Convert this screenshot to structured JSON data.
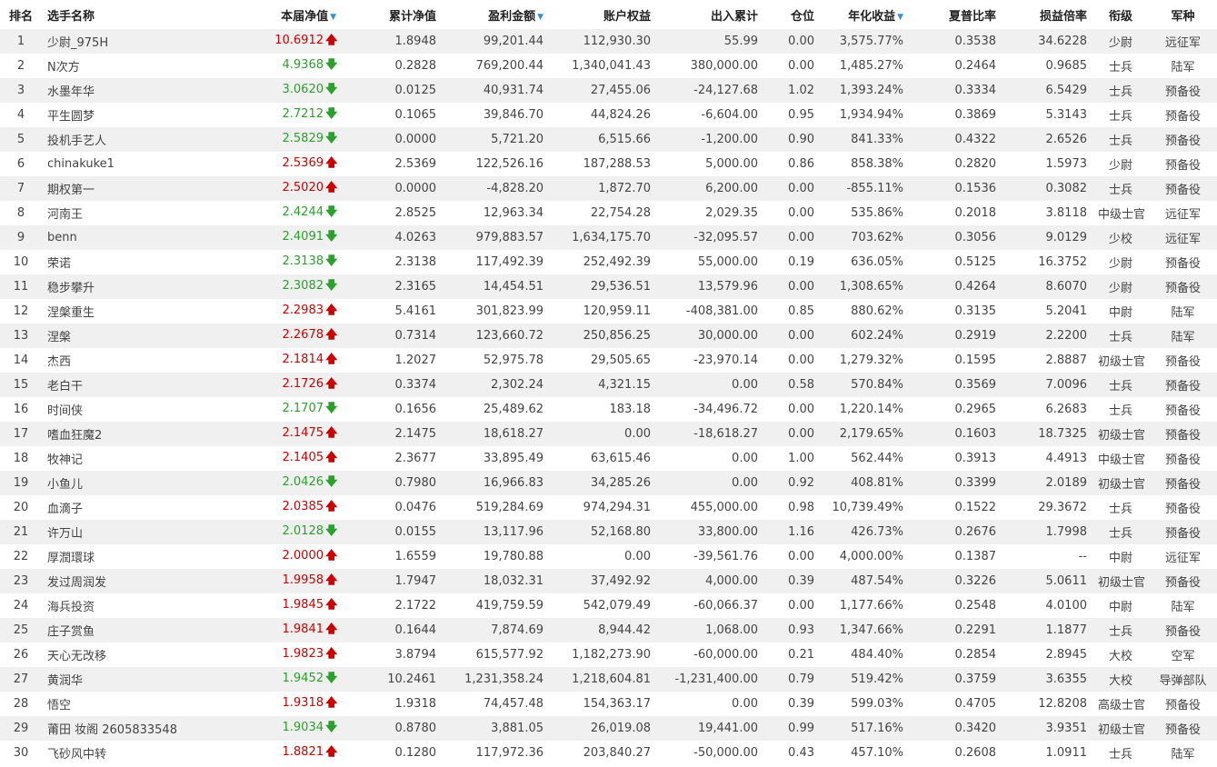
{
  "headers": {
    "rank": "排名",
    "name": "选手名称",
    "nav": "本届净值",
    "cum_nav": "累计净值",
    "profit": "盈利金额",
    "equity": "账户权益",
    "flow": "出入累计",
    "position": "仓位",
    "annual": "年化收益",
    "sharpe": "夏普比率",
    "pl_ratio": "损益倍率",
    "rank_title": "衔级",
    "army": "军种"
  },
  "sortable_columns": [
    "nav",
    "profit",
    "annual"
  ],
  "colors": {
    "up": "#cc0000",
    "down": "#2aa12a",
    "sort": "#3a8fd6",
    "stripe": "#f0f0f0"
  },
  "rows": [
    {
      "rank": "1",
      "name": "少尉_975H",
      "nav": "10.6912",
      "trend": "up",
      "cum_nav": "1.8948",
      "profit": "99,201.44",
      "equity": "112,930.30",
      "flow": "55.99",
      "position": "0.00",
      "annual": "3,575.77%",
      "sharpe": "0.3538",
      "pl_ratio": "34.6228",
      "rank_title": "少尉",
      "army": "远征军"
    },
    {
      "rank": "2",
      "name": "N次方",
      "nav": "4.9368",
      "trend": "down",
      "cum_nav": "0.2828",
      "profit": "769,200.44",
      "equity": "1,340,041.43",
      "flow": "380,000.00",
      "position": "0.00",
      "annual": "1,485.27%",
      "sharpe": "0.2464",
      "pl_ratio": "0.9685",
      "rank_title": "士兵",
      "army": "陆军"
    },
    {
      "rank": "3",
      "name": "水墨年华",
      "nav": "3.0620",
      "trend": "down",
      "cum_nav": "0.0125",
      "profit": "40,931.74",
      "equity": "27,455.06",
      "flow": "-24,127.68",
      "position": "1.02",
      "annual": "1,393.24%",
      "sharpe": "0.3334",
      "pl_ratio": "6.5429",
      "rank_title": "士兵",
      "army": "预备役"
    },
    {
      "rank": "4",
      "name": "平生圆梦",
      "nav": "2.7212",
      "trend": "down",
      "cum_nav": "0.1065",
      "profit": "39,846.70",
      "equity": "44,824.26",
      "flow": "-6,604.00",
      "position": "0.95",
      "annual": "1,934.94%",
      "sharpe": "0.3869",
      "pl_ratio": "5.3143",
      "rank_title": "士兵",
      "army": "预备役"
    },
    {
      "rank": "5",
      "name": "投机手艺人",
      "nav": "2.5829",
      "trend": "down",
      "cum_nav": "0.0000",
      "profit": "5,721.20",
      "equity": "6,515.66",
      "flow": "-1,200.00",
      "position": "0.90",
      "annual": "841.33%",
      "sharpe": "0.4322",
      "pl_ratio": "2.6526",
      "rank_title": "士兵",
      "army": "预备役"
    },
    {
      "rank": "6",
      "name": "chinakuke1",
      "nav": "2.5369",
      "trend": "up",
      "cum_nav": "2.5369",
      "profit": "122,526.16",
      "equity": "187,288.53",
      "flow": "5,000.00",
      "position": "0.86",
      "annual": "858.38%",
      "sharpe": "0.2820",
      "pl_ratio": "1.5973",
      "rank_title": "少尉",
      "army": "预备役"
    },
    {
      "rank": "7",
      "name": "期权第一",
      "nav": "2.5020",
      "trend": "up",
      "cum_nav": "0.0000",
      "profit": "-4,828.20",
      "equity": "1,872.70",
      "flow": "6,200.00",
      "position": "0.00",
      "annual": "-855.11%",
      "sharpe": "0.1536",
      "pl_ratio": "0.3082",
      "rank_title": "士兵",
      "army": "预备役"
    },
    {
      "rank": "8",
      "name": "河南王",
      "nav": "2.4244",
      "trend": "down",
      "cum_nav": "2.8525",
      "profit": "12,963.34",
      "equity": "22,754.28",
      "flow": "2,029.35",
      "position": "0.00",
      "annual": "535.86%",
      "sharpe": "0.2018",
      "pl_ratio": "3.8118",
      "rank_title": "中级士官",
      "army": "远征军"
    },
    {
      "rank": "9",
      "name": "benn",
      "nav": "2.4091",
      "trend": "down",
      "cum_nav": "4.0263",
      "profit": "979,883.57",
      "equity": "1,634,175.70",
      "flow": "-32,095.57",
      "position": "0.00",
      "annual": "703.62%",
      "sharpe": "0.3056",
      "pl_ratio": "9.0129",
      "rank_title": "少校",
      "army": "远征军"
    },
    {
      "rank": "10",
      "name": "荣诺",
      "nav": "2.3138",
      "trend": "down",
      "cum_nav": "2.3138",
      "profit": "117,492.39",
      "equity": "252,492.39",
      "flow": "55,000.00",
      "position": "0.19",
      "annual": "636.05%",
      "sharpe": "0.5125",
      "pl_ratio": "16.3752",
      "rank_title": "少尉",
      "army": "预备役"
    },
    {
      "rank": "11",
      "name": "稳步攀升",
      "nav": "2.3082",
      "trend": "down",
      "cum_nav": "2.3165",
      "profit": "14,454.51",
      "equity": "29,536.51",
      "flow": "13,579.96",
      "position": "0.00",
      "annual": "1,308.65%",
      "sharpe": "0.4264",
      "pl_ratio": "8.6070",
      "rank_title": "少尉",
      "army": "预备役"
    },
    {
      "rank": "12",
      "name": "涅槃重生",
      "nav": "2.2983",
      "trend": "up",
      "cum_nav": "5.4161",
      "profit": "301,823.99",
      "equity": "120,959.11",
      "flow": "-408,381.00",
      "position": "0.85",
      "annual": "880.62%",
      "sharpe": "0.3135",
      "pl_ratio": "5.2041",
      "rank_title": "中尉",
      "army": "陆军"
    },
    {
      "rank": "13",
      "name": "涅槃",
      "nav": "2.2678",
      "trend": "up",
      "cum_nav": "0.7314",
      "profit": "123,660.72",
      "equity": "250,856.25",
      "flow": "30,000.00",
      "position": "0.00",
      "annual": "602.24%",
      "sharpe": "0.2919",
      "pl_ratio": "2.2200",
      "rank_title": "士兵",
      "army": "陆军"
    },
    {
      "rank": "14",
      "name": "杰西",
      "nav": "2.1814",
      "trend": "up",
      "cum_nav": "1.2027",
      "profit": "52,975.78",
      "equity": "29,505.65",
      "flow": "-23,970.14",
      "position": "0.00",
      "annual": "1,279.32%",
      "sharpe": "0.1595",
      "pl_ratio": "2.8887",
      "rank_title": "初级士官",
      "army": "预备役"
    },
    {
      "rank": "15",
      "name": "老白干",
      "nav": "2.1726",
      "trend": "up",
      "cum_nav": "0.3374",
      "profit": "2,302.24",
      "equity": "4,321.15",
      "flow": "0.00",
      "position": "0.58",
      "annual": "570.84%",
      "sharpe": "0.3569",
      "pl_ratio": "7.0096",
      "rank_title": "士兵",
      "army": "预备役"
    },
    {
      "rank": "16",
      "name": "时间侠",
      "nav": "2.1707",
      "trend": "down",
      "cum_nav": "0.1656",
      "profit": "25,489.62",
      "equity": "183.18",
      "flow": "-34,496.72",
      "position": "0.00",
      "annual": "1,220.14%",
      "sharpe": "0.2965",
      "pl_ratio": "6.2683",
      "rank_title": "士兵",
      "army": "预备役"
    },
    {
      "rank": "17",
      "name": "嗜血狂魔2",
      "nav": "2.1475",
      "trend": "up",
      "cum_nav": "2.1475",
      "profit": "18,618.27",
      "equity": "0.00",
      "flow": "-18,618.27",
      "position": "0.00",
      "annual": "2,179.65%",
      "sharpe": "0.1603",
      "pl_ratio": "18.7325",
      "rank_title": "初级士官",
      "army": "预备役"
    },
    {
      "rank": "18",
      "name": "牧神记",
      "nav": "2.1405",
      "trend": "up",
      "cum_nav": "2.3677",
      "profit": "33,895.49",
      "equity": "63,615.46",
      "flow": "0.00",
      "position": "1.00",
      "annual": "562.44%",
      "sharpe": "0.3913",
      "pl_ratio": "4.4913",
      "rank_title": "中级士官",
      "army": "预备役"
    },
    {
      "rank": "19",
      "name": "小鱼儿",
      "nav": "2.0426",
      "trend": "down",
      "cum_nav": "0.7980",
      "profit": "16,966.83",
      "equity": "34,285.26",
      "flow": "0.00",
      "position": "0.92",
      "annual": "408.81%",
      "sharpe": "0.3399",
      "pl_ratio": "2.0189",
      "rank_title": "初级士官",
      "army": "预备役"
    },
    {
      "rank": "20",
      "name": "血滴子",
      "nav": "2.0385",
      "trend": "up",
      "cum_nav": "0.0476",
      "profit": "519,284.69",
      "equity": "974,294.31",
      "flow": "455,000.00",
      "position": "0.98",
      "annual": "10,739.49%",
      "sharpe": "0.1522",
      "pl_ratio": "29.3672",
      "rank_title": "士兵",
      "army": "预备役"
    },
    {
      "rank": "21",
      "name": "许万山",
      "nav": "2.0128",
      "trend": "down",
      "cum_nav": "0.0155",
      "profit": "13,117.96",
      "equity": "52,168.80",
      "flow": "33,800.00",
      "position": "1.16",
      "annual": "426.73%",
      "sharpe": "0.2676",
      "pl_ratio": "1.7998",
      "rank_title": "士兵",
      "army": "预备役"
    },
    {
      "rank": "22",
      "name": "厚潤環球",
      "nav": "2.0000",
      "trend": "up",
      "cum_nav": "1.6559",
      "profit": "19,780.88",
      "equity": "0.00",
      "flow": "-39,561.76",
      "position": "0.00",
      "annual": "4,000.00%",
      "sharpe": "0.1387",
      "pl_ratio": "--",
      "rank_title": "中尉",
      "army": "远征军"
    },
    {
      "rank": "23",
      "name": "发过周润发",
      "nav": "1.9958",
      "trend": "up",
      "cum_nav": "1.7947",
      "profit": "18,032.31",
      "equity": "37,492.92",
      "flow": "4,000.00",
      "position": "0.39",
      "annual": "487.54%",
      "sharpe": "0.3226",
      "pl_ratio": "5.0611",
      "rank_title": "初级士官",
      "army": "预备役"
    },
    {
      "rank": "24",
      "name": "海兵投资",
      "nav": "1.9845",
      "trend": "up",
      "cum_nav": "2.1722",
      "profit": "419,759.59",
      "equity": "542,079.49",
      "flow": "-60,066.37",
      "position": "0.00",
      "annual": "1,177.66%",
      "sharpe": "0.2548",
      "pl_ratio": "4.0100",
      "rank_title": "中尉",
      "army": "陆军"
    },
    {
      "rank": "25",
      "name": "庄子赏鱼",
      "nav": "1.9841",
      "trend": "up",
      "cum_nav": "0.1644",
      "profit": "7,874.69",
      "equity": "8,944.42",
      "flow": "1,068.00",
      "position": "0.93",
      "annual": "1,347.66%",
      "sharpe": "0.2291",
      "pl_ratio": "1.1877",
      "rank_title": "士兵",
      "army": "预备役"
    },
    {
      "rank": "26",
      "name": "天心无改移",
      "nav": "1.9823",
      "trend": "up",
      "cum_nav": "3.8794",
      "profit": "615,577.92",
      "equity": "1,182,273.90",
      "flow": "-60,000.00",
      "position": "0.21",
      "annual": "484.40%",
      "sharpe": "0.2854",
      "pl_ratio": "2.8945",
      "rank_title": "大校",
      "army": "空军"
    },
    {
      "rank": "27",
      "name": "黄润华",
      "nav": "1.9452",
      "trend": "down",
      "cum_nav": "10.2461",
      "profit": "1,231,358.24",
      "equity": "1,218,604.81",
      "flow": "-1,231,400.00",
      "position": "0.79",
      "annual": "519.42%",
      "sharpe": "0.3759",
      "pl_ratio": "3.6355",
      "rank_title": "大校",
      "army": "导弹部队"
    },
    {
      "rank": "28",
      "name": "悟空",
      "nav": "1.9318",
      "trend": "up",
      "cum_nav": "1.9318",
      "profit": "74,457.48",
      "equity": "154,363.17",
      "flow": "0.00",
      "position": "0.39",
      "annual": "599.03%",
      "sharpe": "0.4705",
      "pl_ratio": "12.8208",
      "rank_title": "高级士官",
      "army": "预备役"
    },
    {
      "rank": "29",
      "name": "莆田 妆阁 2605833548",
      "nav": "1.9034",
      "trend": "down",
      "cum_nav": "0.8780",
      "profit": "3,881.05",
      "equity": "26,019.08",
      "flow": "19,441.00",
      "position": "0.99",
      "annual": "517.16%",
      "sharpe": "0.3420",
      "pl_ratio": "3.9351",
      "rank_title": "初级士官",
      "army": "预备役"
    },
    {
      "rank": "30",
      "name": "飞砂风中转",
      "nav": "1.8821",
      "trend": "up",
      "cum_nav": "0.1280",
      "profit": "117,972.36",
      "equity": "203,840.27",
      "flow": "-50,000.00",
      "position": "0.43",
      "annual": "457.10%",
      "sharpe": "0.2608",
      "pl_ratio": "1.0911",
      "rank_title": "士兵",
      "army": "陆军"
    }
  ]
}
